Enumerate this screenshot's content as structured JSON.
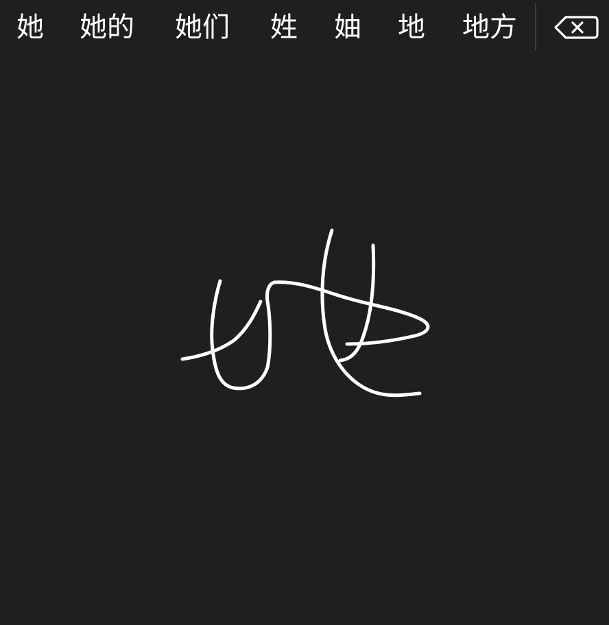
{
  "candidates": [
    "她",
    "她的",
    "她们",
    "姓",
    "妯",
    "地",
    "地方"
  ],
  "icons": {
    "delete": "delete-backspace-icon"
  },
  "colors": {
    "background": "#1f1e21",
    "text": "#ffffff",
    "ink": "#ffffff",
    "divider": "#3e3d42"
  }
}
